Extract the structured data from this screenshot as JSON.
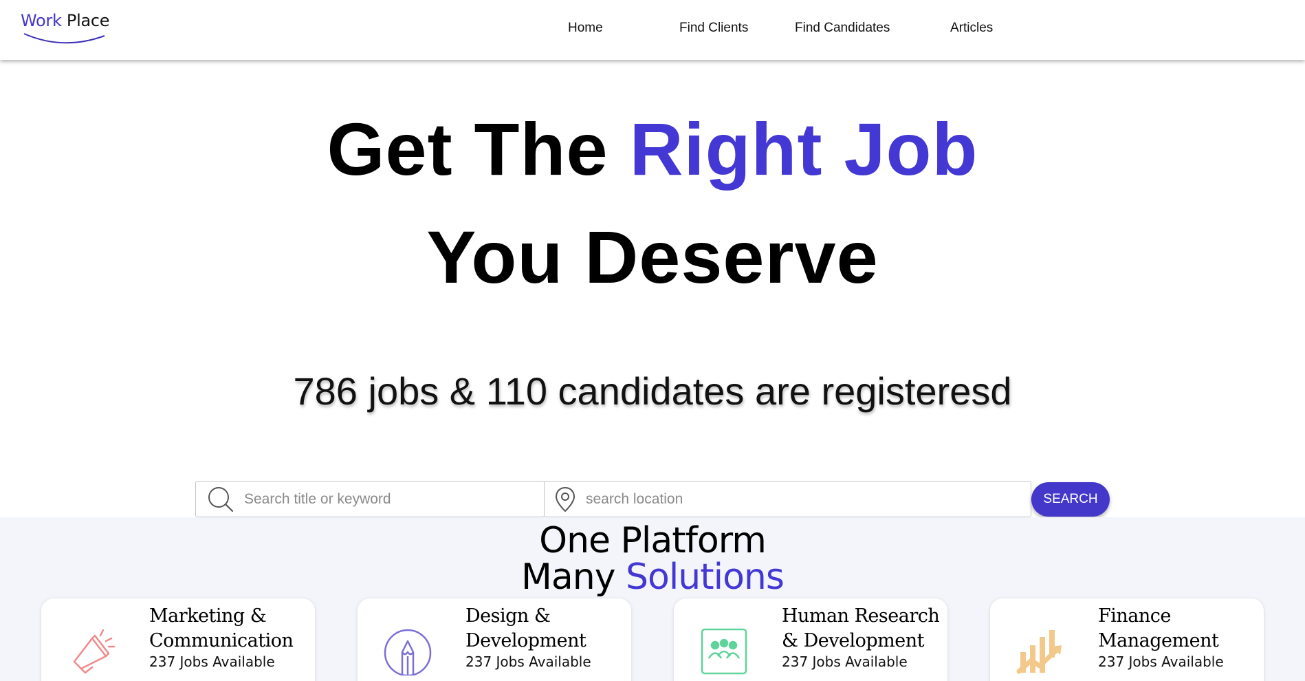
{
  "nav": {
    "logo_work": "Work",
    "logo_place": " Place",
    "links": [
      "Home",
      "Find Clients",
      "Find Candidates",
      "Articles"
    ]
  },
  "hero": {
    "line1_prefix": "Get The ",
    "line1_accent": "Right Job",
    "line2": "You Deserve",
    "stats": "786 jobs & 110 candidates are registeresd"
  },
  "search": {
    "keyword_placeholder": "Search title or keyword",
    "location_placeholder": "search location",
    "button_label": "SEARCH"
  },
  "platform": {
    "title_line1": "One Platform",
    "title_line2_prefix": "Many ",
    "title_line2_accent": "Solutions",
    "categories": [
      {
        "title": "Marketing & Communication",
        "jobs": "237 Jobs Available",
        "icon": "megaphone-icon",
        "color": "#f08a8a"
      },
      {
        "title": "Design & Development",
        "jobs": "237 Jobs Available",
        "icon": "pencil-icon",
        "color": "#7b6fd6"
      },
      {
        "title": "Human Research & Development",
        "jobs": "237 Jobs Available",
        "icon": "team-icon",
        "color": "#5fd49a"
      },
      {
        "title": "Finance Management",
        "jobs": "237 Jobs Available",
        "icon": "growth-chart-icon",
        "color": "#f3c98b"
      }
    ]
  },
  "colors": {
    "accent": "#4338ca",
    "section_bg": "#f4f5fb"
  }
}
